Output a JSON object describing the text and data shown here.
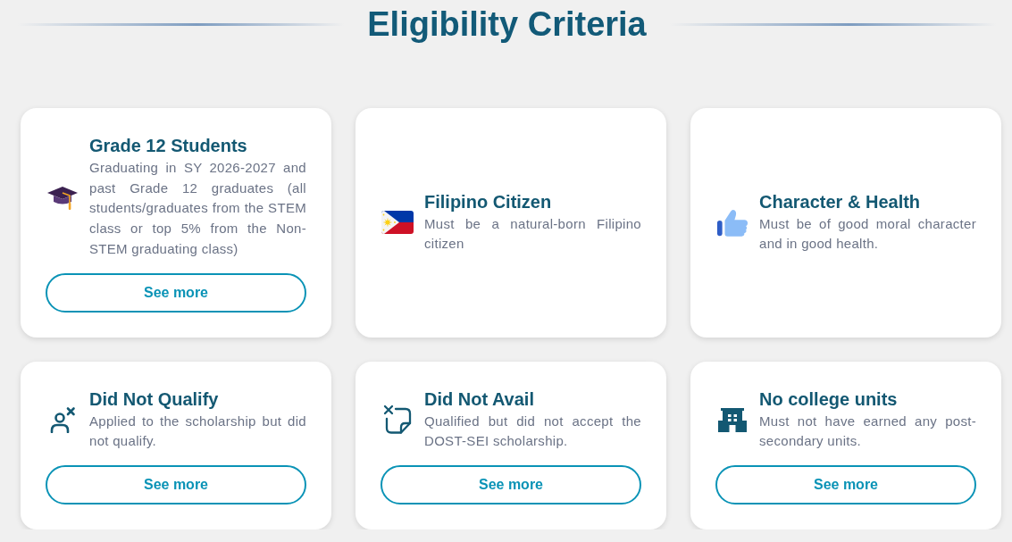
{
  "heading": {
    "title": "Eligibility Criteria"
  },
  "criteria": [
    {
      "title": "Grade 12 Students",
      "description": "Graduating in SY 2026-2027 and past Grade 12 graduates (all students/graduates from the STEM class or top 5% from the Non-STEM graduating class)",
      "button": "See more"
    },
    {
      "title": "Filipino Citizen",
      "description": "Must be a natural-born Filipino citizen"
    },
    {
      "title": "Character & Health",
      "description": "Must be of good moral character and in good health."
    },
    {
      "title": "Did Not Qualify",
      "description": "Applied to the scholarship but did not qualify.",
      "button": "See more"
    },
    {
      "title": "Did Not Avail",
      "description": "Qualified but did not accept the DOST-SEI scholarship.",
      "button": "See more"
    },
    {
      "title": "No college units",
      "description": "Must not have earned any post-secondary units.",
      "button": "See more"
    }
  ]
}
